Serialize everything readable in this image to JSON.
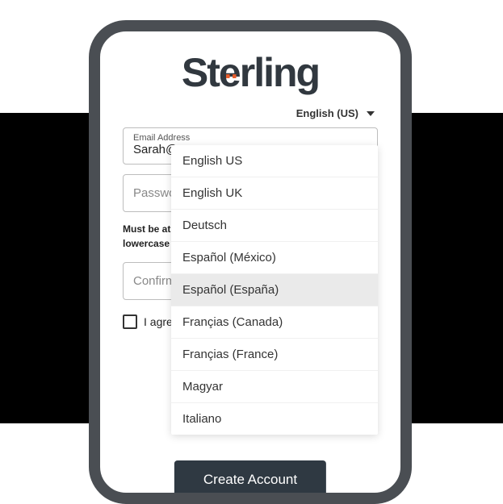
{
  "logo": {
    "text": "Sterling"
  },
  "language_selector": {
    "current": "English (US)",
    "options": [
      {
        "label": "English US",
        "selected": false
      },
      {
        "label": "English UK",
        "selected": false
      },
      {
        "label": "Deutsch",
        "selected": false
      },
      {
        "label": "Español (México)",
        "selected": false
      },
      {
        "label": "Español (España)",
        "selected": true
      },
      {
        "label": "Françias (Canada)",
        "selected": false
      },
      {
        "label": "Françias (France)",
        "selected": false
      },
      {
        "label": "Magyar",
        "selected": false
      },
      {
        "label": "Italiano",
        "selected": false
      }
    ]
  },
  "form": {
    "email": {
      "label": "Email Address",
      "value": "Sarah@"
    },
    "password": {
      "placeholder": "Password"
    },
    "hint": "Must be at least 8 characters, contain an uppercase, lowercase letter, a number and a special character.",
    "confirm_password": {
      "placeholder": "Confirm Password"
    },
    "agree": {
      "label": "I agree to the Terms"
    },
    "submit": "Create Account"
  }
}
